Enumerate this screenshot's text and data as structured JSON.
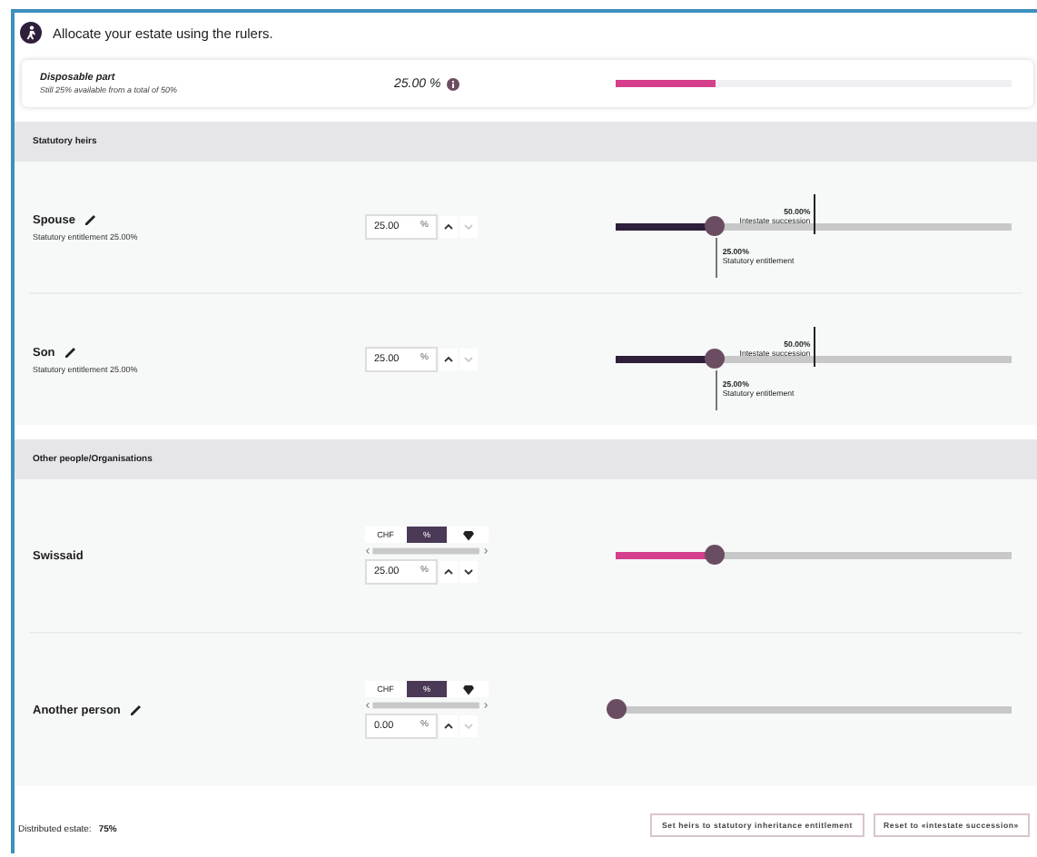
{
  "title": "Allocate your estate using the rulers.",
  "disposable": {
    "label": "Disposable part",
    "subtitle": "Still 25% available from a total of 50%",
    "value": "25.00 %",
    "level": 0.25
  },
  "sections": [
    {
      "title": "Statutory heirs",
      "rows": [
        {
          "kind": "heir",
          "name": "Spouse",
          "editable": true,
          "subtitle": "Statutory entitlement 25.00%",
          "value": "25.00",
          "unit": "%",
          "up_disabled": false,
          "down_disabled": true,
          "level": 0.25,
          "markers": [
            {
              "kind": "upper",
              "level": 0.5,
              "value": "50.00%",
              "label": "Intestate succession"
            },
            {
              "kind": "lower",
              "level": 0.25,
              "value": "25.00%",
              "label": "Statutory entitlement"
            }
          ]
        },
        {
          "kind": "heir",
          "name": "Son",
          "editable": true,
          "subtitle": "Statutory entitlement 25.00%",
          "value": "25.00",
          "unit": "%",
          "up_disabled": false,
          "down_disabled": true,
          "level": 0.25,
          "markers": [
            {
              "kind": "upper",
              "level": 0.5,
              "value": "50.00%",
              "label": "Intestate succession"
            },
            {
              "kind": "lower",
              "level": 0.25,
              "value": "25.00%",
              "label": "Statutory entitlement"
            }
          ]
        }
      ]
    },
    {
      "title": "Other people/Organisations",
      "rows": [
        {
          "kind": "other",
          "name": "Swissaid",
          "editable": false,
          "value": "25.00",
          "unit": "%",
          "up_disabled": false,
          "down_disabled": false,
          "level": 0.25,
          "units": [
            {
              "kind": "text",
              "label": "CHF",
              "selected": false
            },
            {
              "kind": "text",
              "label": "%",
              "selected": true
            },
            {
              "kind": "icon",
              "selected": false
            }
          ]
        },
        {
          "kind": "other",
          "name": "Another person",
          "editable": true,
          "value": "0.00",
          "unit": "%",
          "up_disabled": false,
          "down_disabled": true,
          "level": 0,
          "units": [
            {
              "kind": "text",
              "label": "CHF",
              "selected": false
            },
            {
              "kind": "text",
              "label": "%",
              "selected": true
            },
            {
              "kind": "icon",
              "selected": false
            }
          ]
        }
      ]
    }
  ],
  "footer": {
    "label": "Distributed estate:",
    "value": "75%",
    "buttons": [
      "Set heirs to statutory inheritance entitlement",
      "Reset to «intestate succession»"
    ]
  }
}
